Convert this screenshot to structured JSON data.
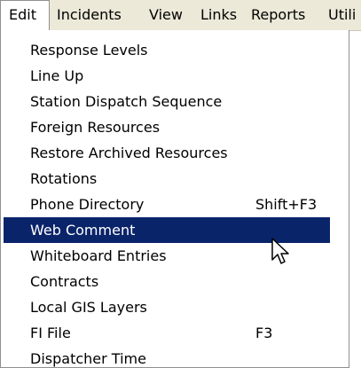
{
  "menubar": {
    "items": [
      {
        "label": "Edit"
      },
      {
        "label": "Incidents"
      },
      {
        "label": "View"
      },
      {
        "label": "Links"
      },
      {
        "label": "Reports"
      },
      {
        "label": "Utili"
      }
    ]
  },
  "edit_menu": {
    "items": [
      {
        "label": "Response Levels",
        "shortcut": ""
      },
      {
        "label": "Line Up",
        "shortcut": ""
      },
      {
        "label": "Station Dispatch Sequence",
        "shortcut": ""
      },
      {
        "label": "Foreign Resources",
        "shortcut": ""
      },
      {
        "label": "Restore Archived Resources",
        "shortcut": ""
      },
      {
        "label": "Rotations",
        "shortcut": ""
      },
      {
        "label": "Phone Directory",
        "shortcut": "Shift+F3"
      },
      {
        "label": "Web Comment",
        "shortcut": ""
      },
      {
        "label": "Whiteboard Entries",
        "shortcut": ""
      },
      {
        "label": "Contracts",
        "shortcut": ""
      },
      {
        "label": "Local GIS Layers",
        "shortcut": ""
      },
      {
        "label": "FI File",
        "shortcut": "F3"
      },
      {
        "label": "Dispatcher Time",
        "shortcut": ""
      }
    ],
    "highlighted_item": "Web Comment"
  },
  "colors": {
    "menubar_bg": "#ECE9D8",
    "highlight_bg": "#0A246A",
    "highlight_text": "#FFFFFF"
  },
  "icons": {
    "cursor": "arrow-pointer-icon"
  }
}
